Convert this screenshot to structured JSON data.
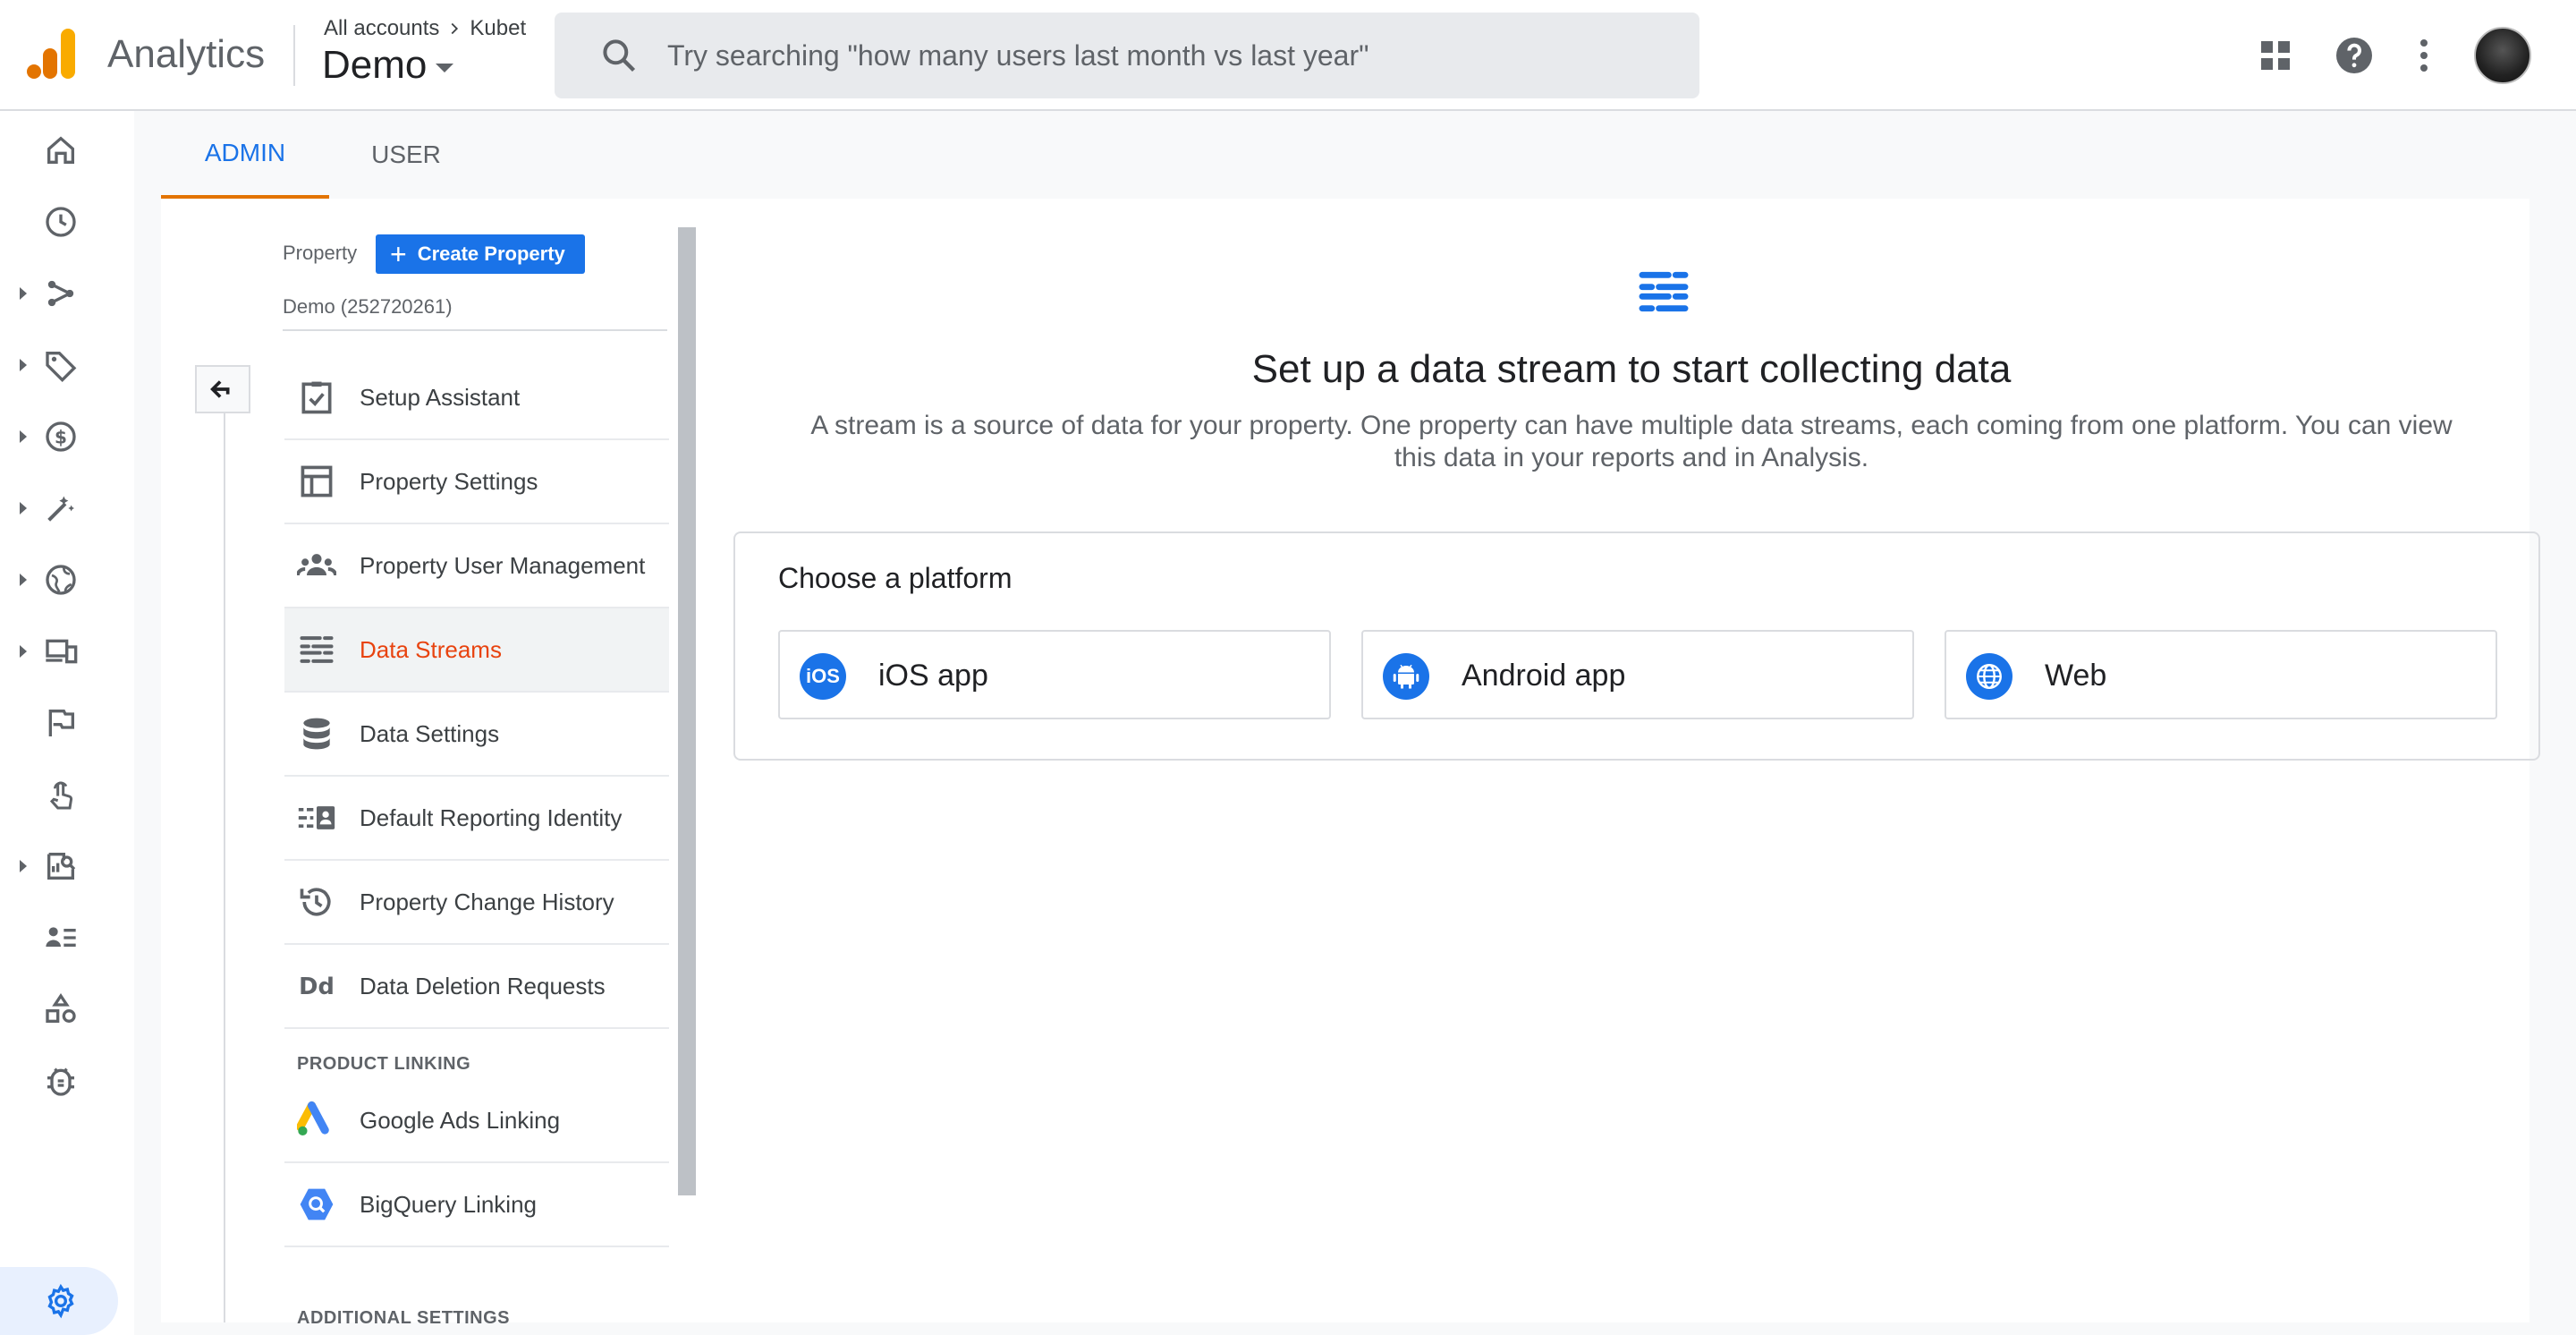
{
  "app": {
    "name": "Analytics"
  },
  "breadcrumb": {
    "account": "All accounts",
    "sub": "Kubet"
  },
  "property_selector": {
    "name": "Demo"
  },
  "search": {
    "placeholder": "Try searching \"how many users last month vs last year\""
  },
  "tabs": {
    "admin": "ADMIN",
    "user": "USER"
  },
  "property": {
    "label": "Property",
    "create_button": "Create Property",
    "id_text": "Demo (252720261)"
  },
  "menu": {
    "items": [
      {
        "label": "Setup Assistant",
        "icon": "checklist-icon"
      },
      {
        "label": "Property Settings",
        "icon": "layout-icon"
      },
      {
        "label": "Property User Management",
        "icon": "group-icon"
      },
      {
        "label": "Data Streams",
        "icon": "streams-icon",
        "active": true
      },
      {
        "label": "Data Settings",
        "icon": "database-icon"
      },
      {
        "label": "Default Reporting Identity",
        "icon": "identity-icon"
      },
      {
        "label": "Property Change History",
        "icon": "history-icon"
      },
      {
        "label": "Data Deletion Requests",
        "icon": "dd-icon"
      }
    ],
    "section_product_linking": "PRODUCT LINKING",
    "linking_items": [
      {
        "label": "Google Ads Linking",
        "icon": "google-ads-icon"
      },
      {
        "label": "BigQuery Linking",
        "icon": "bigquery-icon"
      }
    ],
    "section_additional": "ADDITIONAL SETTINGS"
  },
  "main": {
    "title": "Set up a data stream to start collecting data",
    "description_line1": "A stream is a source of data for your property. One property can have multiple data streams, each coming from one platform. You can view",
    "description_line2": "this data in your reports and in Analysis.",
    "choose_title": "Choose a platform",
    "platforms": [
      {
        "label": "iOS app",
        "icon_text": "iOS"
      },
      {
        "label": "Android app"
      },
      {
        "label": "Web"
      }
    ]
  },
  "colors": {
    "accent": "#1a73e8",
    "active_menu_text": "#e8430f",
    "tab_underline": "#e37400"
  }
}
